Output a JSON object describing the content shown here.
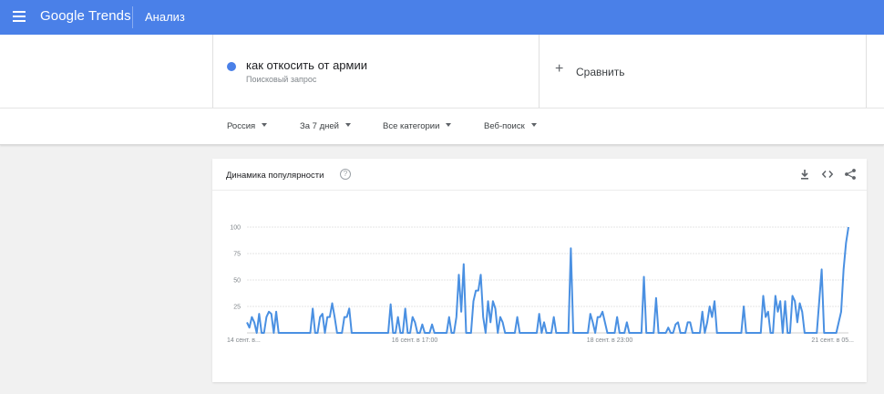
{
  "header": {
    "menu_icon": "menu-icon",
    "logo": "Google Trends",
    "section": "Анализ",
    "brand_color": "#4a80e8"
  },
  "search": {
    "term": "как откосить от армии",
    "term_type": "Поисковый запрос",
    "term_color": "#4a80e8",
    "compare_icon": "plus-icon",
    "compare_label": "Сравнить"
  },
  "filters": {
    "region": "Россия",
    "period": "За 7 дней",
    "category": "Все категории",
    "search_type": "Веб-поиск"
  },
  "card": {
    "title": "Динамика популярности",
    "help_icon": "help-icon",
    "download_icon": "download-icon",
    "embed_icon": "embed-icon",
    "share_icon": "share-icon"
  },
  "chart_data": {
    "type": "line",
    "series": [
      {
        "color": "#4a90e2",
        "values": [
          10,
          5,
          15,
          10,
          0,
          18,
          0,
          0,
          15,
          20,
          18,
          0,
          20,
          0,
          0,
          0,
          0,
          0,
          0,
          0,
          0,
          0,
          0,
          0,
          0,
          0,
          0,
          23,
          0,
          0,
          15,
          18,
          0,
          15,
          15,
          28,
          15,
          0,
          0,
          0,
          15,
          15,
          23,
          0,
          0,
          0,
          0,
          0,
          0,
          0,
          0,
          0,
          0,
          0,
          0,
          0,
          0,
          0,
          0,
          27,
          0,
          0,
          15,
          0,
          0,
          23,
          0,
          0,
          15,
          10,
          0,
          0,
          8,
          0,
          0,
          0,
          8,
          0,
          0,
          0,
          0,
          0,
          0,
          15,
          0,
          0,
          15,
          55,
          20,
          65,
          0,
          0,
          0,
          30,
          40,
          40,
          55,
          15,
          0,
          30,
          10,
          30,
          23,
          0,
          15,
          10,
          0,
          0,
          0,
          0,
          0,
          15,
          0,
          0,
          0,
          0,
          0,
          0,
          0,
          0,
          18,
          0,
          10,
          0,
          0,
          0,
          15,
          0,
          0,
          0,
          0,
          0,
          0,
          80,
          0,
          0,
          0,
          0,
          0,
          0,
          0,
          18,
          10,
          0,
          15,
          15,
          20,
          10,
          0,
          0,
          0,
          0,
          15,
          0,
          0,
          0,
          10,
          0,
          0,
          0,
          0,
          0,
          0,
          53,
          0,
          0,
          0,
          0,
          33,
          0,
          0,
          0,
          0,
          5,
          0,
          0,
          8,
          10,
          0,
          0,
          0,
          10,
          10,
          0,
          0,
          0,
          0,
          20,
          0,
          10,
          25,
          15,
          30,
          0,
          0,
          0,
          0,
          0,
          0,
          0,
          0,
          0,
          0,
          0,
          25,
          0,
          0,
          0,
          0,
          0,
          0,
          0,
          35,
          15,
          20,
          0,
          0,
          35,
          20,
          30,
          0,
          30,
          0,
          0,
          35,
          30,
          10,
          28,
          20,
          0,
          0,
          0,
          0,
          0,
          0,
          30,
          60,
          0,
          0,
          0,
          0,
          0,
          0,
          10,
          20,
          60,
          85,
          100
        ]
      }
    ],
    "x_tick_labels": [
      "14 сент. в...",
      "16 сент. в 17:00",
      "18 сент. в 23:00",
      "21 сент. в 05..."
    ],
    "y_ticks": [
      100,
      75,
      50,
      25
    ],
    "ylim": [
      0,
      100
    ],
    "grid": true
  }
}
